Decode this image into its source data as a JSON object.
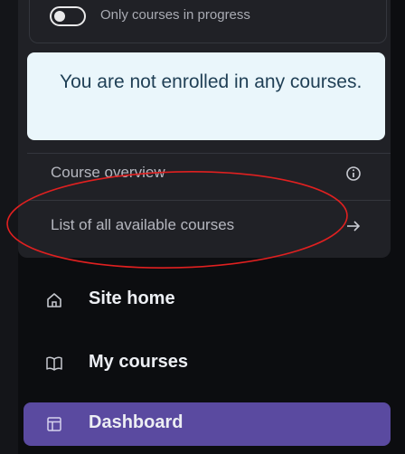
{
  "filter": {
    "toggle_label": "Only courses in progress"
  },
  "notice": {
    "message": "You are not enrolled in any courses."
  },
  "course_links": [
    {
      "label": "Course overview",
      "icon": "info-icon"
    },
    {
      "label": "List of all available courses",
      "icon": "arrow-right-icon"
    }
  ],
  "nav": [
    {
      "label": "Site home",
      "icon": "home-icon",
      "active": false
    },
    {
      "label": "My courses",
      "icon": "book-icon",
      "active": false
    },
    {
      "label": "Dashboard",
      "icon": "dashboard-icon",
      "active": true
    }
  ],
  "colors": {
    "background": "#0c0d10",
    "panel": "#202126",
    "notice_bg": "#eaf6fb",
    "notice_text": "#1f3f55",
    "active_nav": "#5a4aa0",
    "annotation": "#e02020"
  }
}
